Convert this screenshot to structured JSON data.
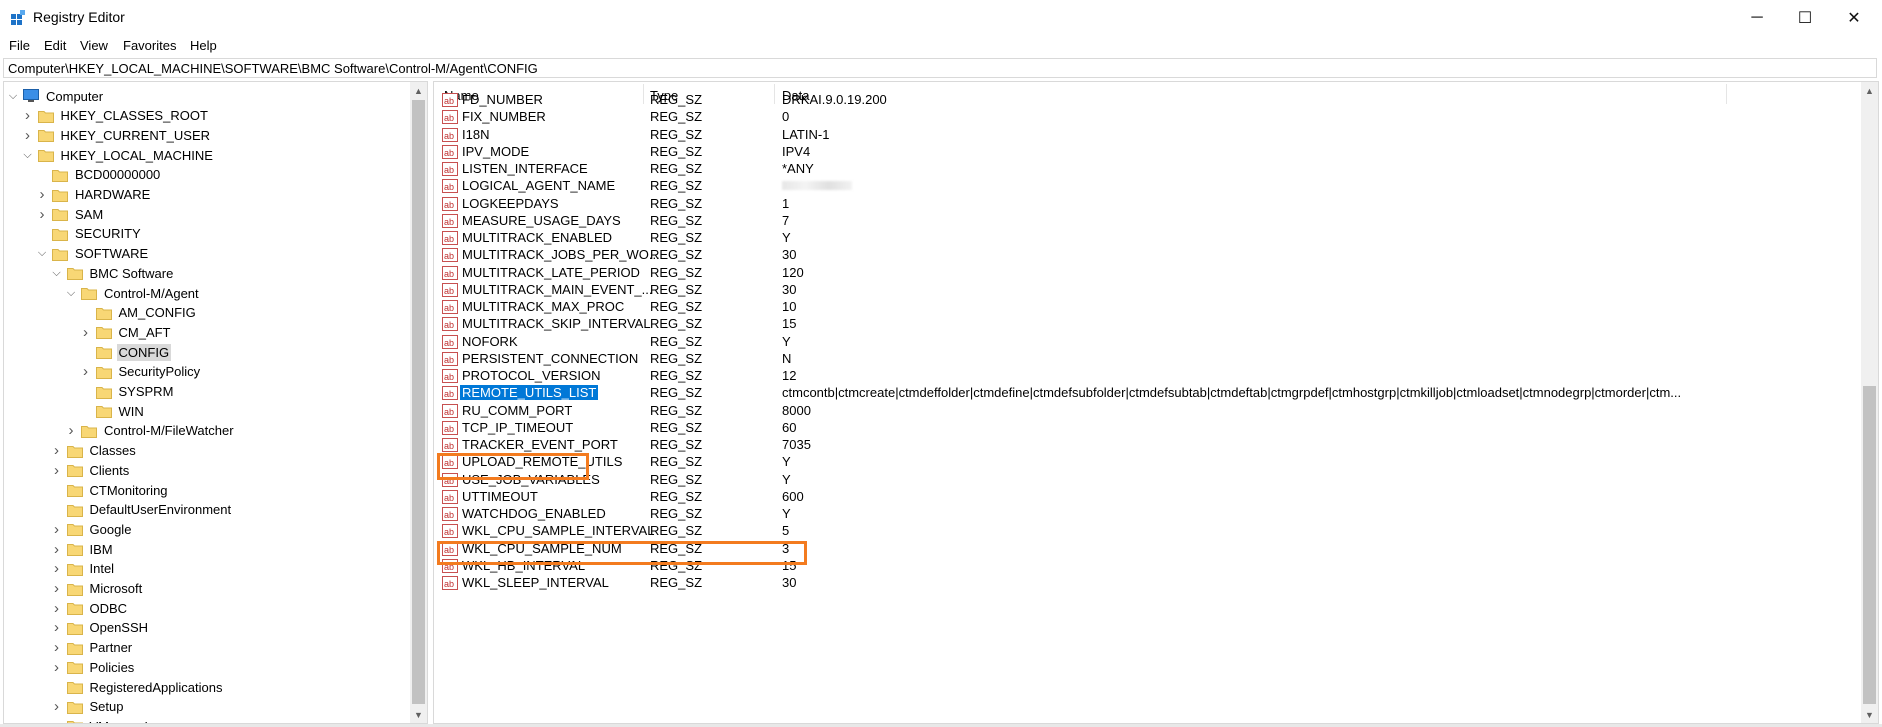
{
  "window": {
    "title": "Registry Editor",
    "minimize_glyph": "─",
    "maximize_glyph": "☐",
    "close_glyph": "✕"
  },
  "menu": [
    "File",
    "Edit",
    "View",
    "Favorites",
    "Help"
  ],
  "address": "Computer\\HKEY_LOCAL_MACHINE\\SOFTWARE\\BMC Software\\Control-M/Agent\\CONFIG",
  "tree": [
    {
      "label": "Computer",
      "depth": 0,
      "expander": "expanded",
      "icon": "computer-icon"
    },
    {
      "label": "HKEY_CLASSES_ROOT",
      "depth": 1,
      "expander": "collapsed",
      "icon": "folder-icon"
    },
    {
      "label": "HKEY_CURRENT_USER",
      "depth": 1,
      "expander": "collapsed",
      "icon": "folder-icon"
    },
    {
      "label": "HKEY_LOCAL_MACHINE",
      "depth": 1,
      "expander": "expanded",
      "icon": "folder-icon"
    },
    {
      "label": "BCD00000000",
      "depth": 2,
      "expander": "none",
      "icon": "folder-icon"
    },
    {
      "label": "HARDWARE",
      "depth": 2,
      "expander": "collapsed",
      "icon": "folder-icon"
    },
    {
      "label": "SAM",
      "depth": 2,
      "expander": "collapsed",
      "icon": "folder-icon"
    },
    {
      "label": "SECURITY",
      "depth": 2,
      "expander": "none",
      "icon": "folder-icon"
    },
    {
      "label": "SOFTWARE",
      "depth": 2,
      "expander": "expanded",
      "icon": "folder-icon"
    },
    {
      "label": "BMC Software",
      "depth": 3,
      "expander": "expanded",
      "icon": "folder-icon"
    },
    {
      "label": "Control-M/Agent",
      "depth": 4,
      "expander": "expanded",
      "icon": "folder-icon"
    },
    {
      "label": "AM_CONFIG",
      "depth": 5,
      "expander": "none",
      "icon": "folder-icon"
    },
    {
      "label": "CM_AFT",
      "depth": 5,
      "expander": "collapsed",
      "icon": "folder-icon"
    },
    {
      "label": "CONFIG",
      "depth": 5,
      "expander": "none",
      "icon": "folder-icon",
      "selected": true
    },
    {
      "label": "SecurityPolicy",
      "depth": 5,
      "expander": "collapsed",
      "icon": "folder-icon"
    },
    {
      "label": "SYSPRM",
      "depth": 5,
      "expander": "none",
      "icon": "folder-icon"
    },
    {
      "label": "WIN",
      "depth": 5,
      "expander": "none",
      "icon": "folder-icon"
    },
    {
      "label": "Control-M/FileWatcher",
      "depth": 4,
      "expander": "collapsed",
      "icon": "folder-icon"
    },
    {
      "label": "Classes",
      "depth": 3,
      "expander": "collapsed",
      "icon": "folder-icon"
    },
    {
      "label": "Clients",
      "depth": 3,
      "expander": "collapsed",
      "icon": "folder-icon"
    },
    {
      "label": "CTMonitoring",
      "depth": 3,
      "expander": "none",
      "icon": "folder-icon"
    },
    {
      "label": "DefaultUserEnvironment",
      "depth": 3,
      "expander": "none",
      "icon": "folder-icon"
    },
    {
      "label": "Google",
      "depth": 3,
      "expander": "collapsed",
      "icon": "folder-icon"
    },
    {
      "label": "IBM",
      "depth": 3,
      "expander": "collapsed",
      "icon": "folder-icon"
    },
    {
      "label": "Intel",
      "depth": 3,
      "expander": "collapsed",
      "icon": "folder-icon"
    },
    {
      "label": "Microsoft",
      "depth": 3,
      "expander": "collapsed",
      "icon": "folder-icon"
    },
    {
      "label": "ODBC",
      "depth": 3,
      "expander": "collapsed",
      "icon": "folder-icon"
    },
    {
      "label": "OpenSSH",
      "depth": 3,
      "expander": "collapsed",
      "icon": "folder-icon"
    },
    {
      "label": "Partner",
      "depth": 3,
      "expander": "collapsed",
      "icon": "folder-icon"
    },
    {
      "label": "Policies",
      "depth": 3,
      "expander": "collapsed",
      "icon": "folder-icon"
    },
    {
      "label": "RegisteredApplications",
      "depth": 3,
      "expander": "none",
      "icon": "folder-icon"
    },
    {
      "label": "Setup",
      "depth": 3,
      "expander": "collapsed",
      "icon": "folder-icon"
    },
    {
      "label": "VMware, Inc.",
      "depth": 3,
      "expander": "collapsed",
      "icon": "folder-icon"
    }
  ],
  "columns": {
    "name": "Name",
    "type": "Type",
    "data": "Data"
  },
  "values": [
    {
      "name": "FD_NUMBER",
      "type": "REG_SZ",
      "data": "DRKAI.9.0.19.200"
    },
    {
      "name": "FIX_NUMBER",
      "type": "REG_SZ",
      "data": "0"
    },
    {
      "name": "I18N",
      "type": "REG_SZ",
      "data": "LATIN-1"
    },
    {
      "name": "IPV_MODE",
      "type": "REG_SZ",
      "data": "IPV4"
    },
    {
      "name": "LISTEN_INTERFACE",
      "type": "REG_SZ",
      "data": "*ANY"
    },
    {
      "name": "LOGICAL_AGENT_NAME",
      "type": "REG_SZ",
      "data": "",
      "blurred": true
    },
    {
      "name": "LOGKEEPDAYS",
      "type": "REG_SZ",
      "data": "1"
    },
    {
      "name": "MEASURE_USAGE_DAYS",
      "type": "REG_SZ",
      "data": "7"
    },
    {
      "name": "MULTITRACK_ENABLED",
      "type": "REG_SZ",
      "data": "Y"
    },
    {
      "name": "MULTITRACK_JOBS_PER_WO...",
      "type": "REG_SZ",
      "data": "30"
    },
    {
      "name": "MULTITRACK_LATE_PERIOD",
      "type": "REG_SZ",
      "data": "120"
    },
    {
      "name": "MULTITRACK_MAIN_EVENT_...",
      "type": "REG_SZ",
      "data": "30"
    },
    {
      "name": "MULTITRACK_MAX_PROC",
      "type": "REG_SZ",
      "data": "10"
    },
    {
      "name": "MULTITRACK_SKIP_INTERVAL",
      "type": "REG_SZ",
      "data": "15"
    },
    {
      "name": "NOFORK",
      "type": "REG_SZ",
      "data": "Y"
    },
    {
      "name": "PERSISTENT_CONNECTION",
      "type": "REG_SZ",
      "data": "N"
    },
    {
      "name": "PROTOCOL_VERSION",
      "type": "REG_SZ",
      "data": "12"
    },
    {
      "name": "REMOTE_UTILS_LIST",
      "type": "REG_SZ",
      "data": "ctmcontb|ctmcreate|ctmdeffolder|ctmdefine|ctmdefsubfolder|ctmdefsubtab|ctmdeftab|ctmgrpdef|ctmhostgrp|ctmkilljob|ctmloadset|ctmnodegrp|ctmorder|ctm...",
      "selected": true
    },
    {
      "name": "RU_COMM_PORT",
      "type": "REG_SZ",
      "data": "8000"
    },
    {
      "name": "TCP_IP_TIMEOUT",
      "type": "REG_SZ",
      "data": "60"
    },
    {
      "name": "TRACKER_EVENT_PORT",
      "type": "REG_SZ",
      "data": "7035"
    },
    {
      "name": "UPLOAD_REMOTE_UTILS",
      "type": "REG_SZ",
      "data": "Y"
    },
    {
      "name": "USE_JOB_VARIABLES",
      "type": "REG_SZ",
      "data": "Y"
    },
    {
      "name": "UTTIMEOUT",
      "type": "REG_SZ",
      "data": "600"
    },
    {
      "name": "WATCHDOG_ENABLED",
      "type": "REG_SZ",
      "data": "Y"
    },
    {
      "name": "WKL_CPU_SAMPLE_INTERVAL",
      "type": "REG_SZ",
      "data": "5"
    },
    {
      "name": "WKL_CPU_SAMPLE_NUM",
      "type": "REG_SZ",
      "data": "3"
    },
    {
      "name": "WKL_HB_INTERVAL",
      "type": "REG_SZ",
      "data": "15"
    },
    {
      "name": "WKL_SLEEP_INTERVAL",
      "type": "REG_SZ",
      "data": "30"
    }
  ],
  "highlight_color": "#f37b1f",
  "selection_color": "#0078d7"
}
